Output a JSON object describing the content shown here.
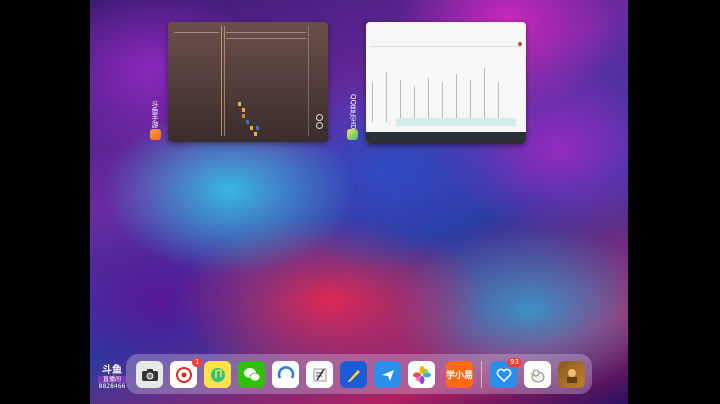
{
  "switcher": {
    "apps": [
      {
        "name": "斗鱼手游",
        "icon": "app-icon-orange"
      },
      {
        "name": "QQ音乐HD",
        "icon": "app-icon-green"
      }
    ]
  },
  "dock": {
    "items": [
      {
        "name": "camera",
        "icon": "camera-icon"
      },
      {
        "name": "netease-music",
        "icon": "netease-icon",
        "badge": "1"
      },
      {
        "name": "qq-music",
        "icon": "music-icon"
      },
      {
        "name": "wechat",
        "icon": "wechat-icon"
      },
      {
        "name": "browser",
        "icon": "browser-icon"
      },
      {
        "name": "notes",
        "icon": "notes-icon"
      },
      {
        "name": "pen",
        "icon": "pen-icon"
      },
      {
        "name": "bird",
        "icon": "bird-icon"
      },
      {
        "name": "photos",
        "icon": "photos-icon"
      },
      {
        "name": "study",
        "icon": "study-icon",
        "label": "学小易"
      },
      {
        "name": "health",
        "icon": "health-icon",
        "badge": "93"
      },
      {
        "name": "goose",
        "icon": "goose-icon"
      },
      {
        "name": "game",
        "icon": "game-icon"
      }
    ]
  },
  "overlay": {
    "logo_big": "斗鱼",
    "logo_small": "直播间",
    "room": "8828466"
  }
}
